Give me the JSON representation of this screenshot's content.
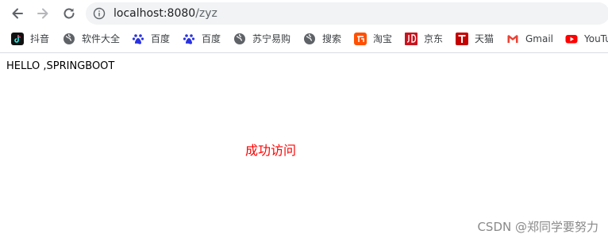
{
  "browser": {
    "address_bar": {
      "host": "localhost:8080",
      "path": "/zyz"
    },
    "bookmarks": [
      {
        "label": "抖音",
        "icon": "douyin-icon"
      },
      {
        "label": "软件大全",
        "icon": "globe-icon"
      },
      {
        "label": "百度",
        "icon": "baidu-paw-icon"
      },
      {
        "label": "百度",
        "icon": "baidu-paw-icon"
      },
      {
        "label": "苏宁易购",
        "icon": "globe-icon"
      },
      {
        "label": "搜索",
        "icon": "globe-icon"
      },
      {
        "label": "淘宝",
        "icon": "taobao-icon"
      },
      {
        "label": "京东",
        "icon": "jd-icon"
      },
      {
        "label": "天猫",
        "icon": "tmall-icon"
      },
      {
        "label": "Gmail",
        "icon": "gmail-icon"
      },
      {
        "label": "YouTu",
        "icon": "youtube-icon"
      }
    ]
  },
  "page": {
    "heading": "HELLO ,SPRINGBOOT",
    "message": "成功访问",
    "message_color": "#ff0000"
  },
  "watermark": "CSDN @郑同学要努力"
}
